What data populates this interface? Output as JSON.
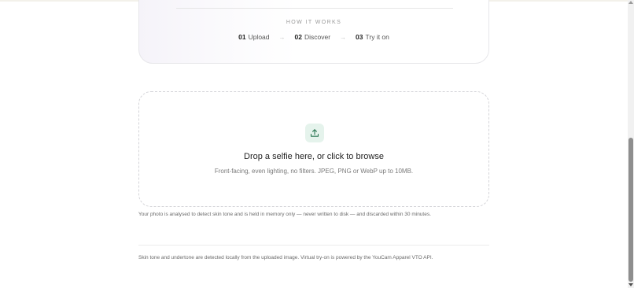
{
  "how_it_works": {
    "heading": "HOW IT WORKS",
    "steps": [
      {
        "number": "01",
        "label": "Upload"
      },
      {
        "number": "02",
        "label": "Discover"
      },
      {
        "number": "03",
        "label": "Try it on"
      }
    ],
    "arrow": "→"
  },
  "upload": {
    "icon": "upload-icon",
    "title": "Drop a selfie here, or click to browse",
    "subtitle": "Front-facing, even lighting, no filters. JPEG, PNG or WebP up to 10MB."
  },
  "privacy_note": "Your photo is analysed to detect skin tone and is held in memory only — never written to disk — and discarded within 30 minutes.",
  "footer_note": "Skin tone and undertone are detected locally from the uploaded image. Virtual try-on is powered by the YouCam Apparel VTO API.",
  "colors": {
    "icon_bg": "#e5f3ec",
    "icon_stroke": "#2f7a56",
    "border": "#d4d4d8"
  }
}
